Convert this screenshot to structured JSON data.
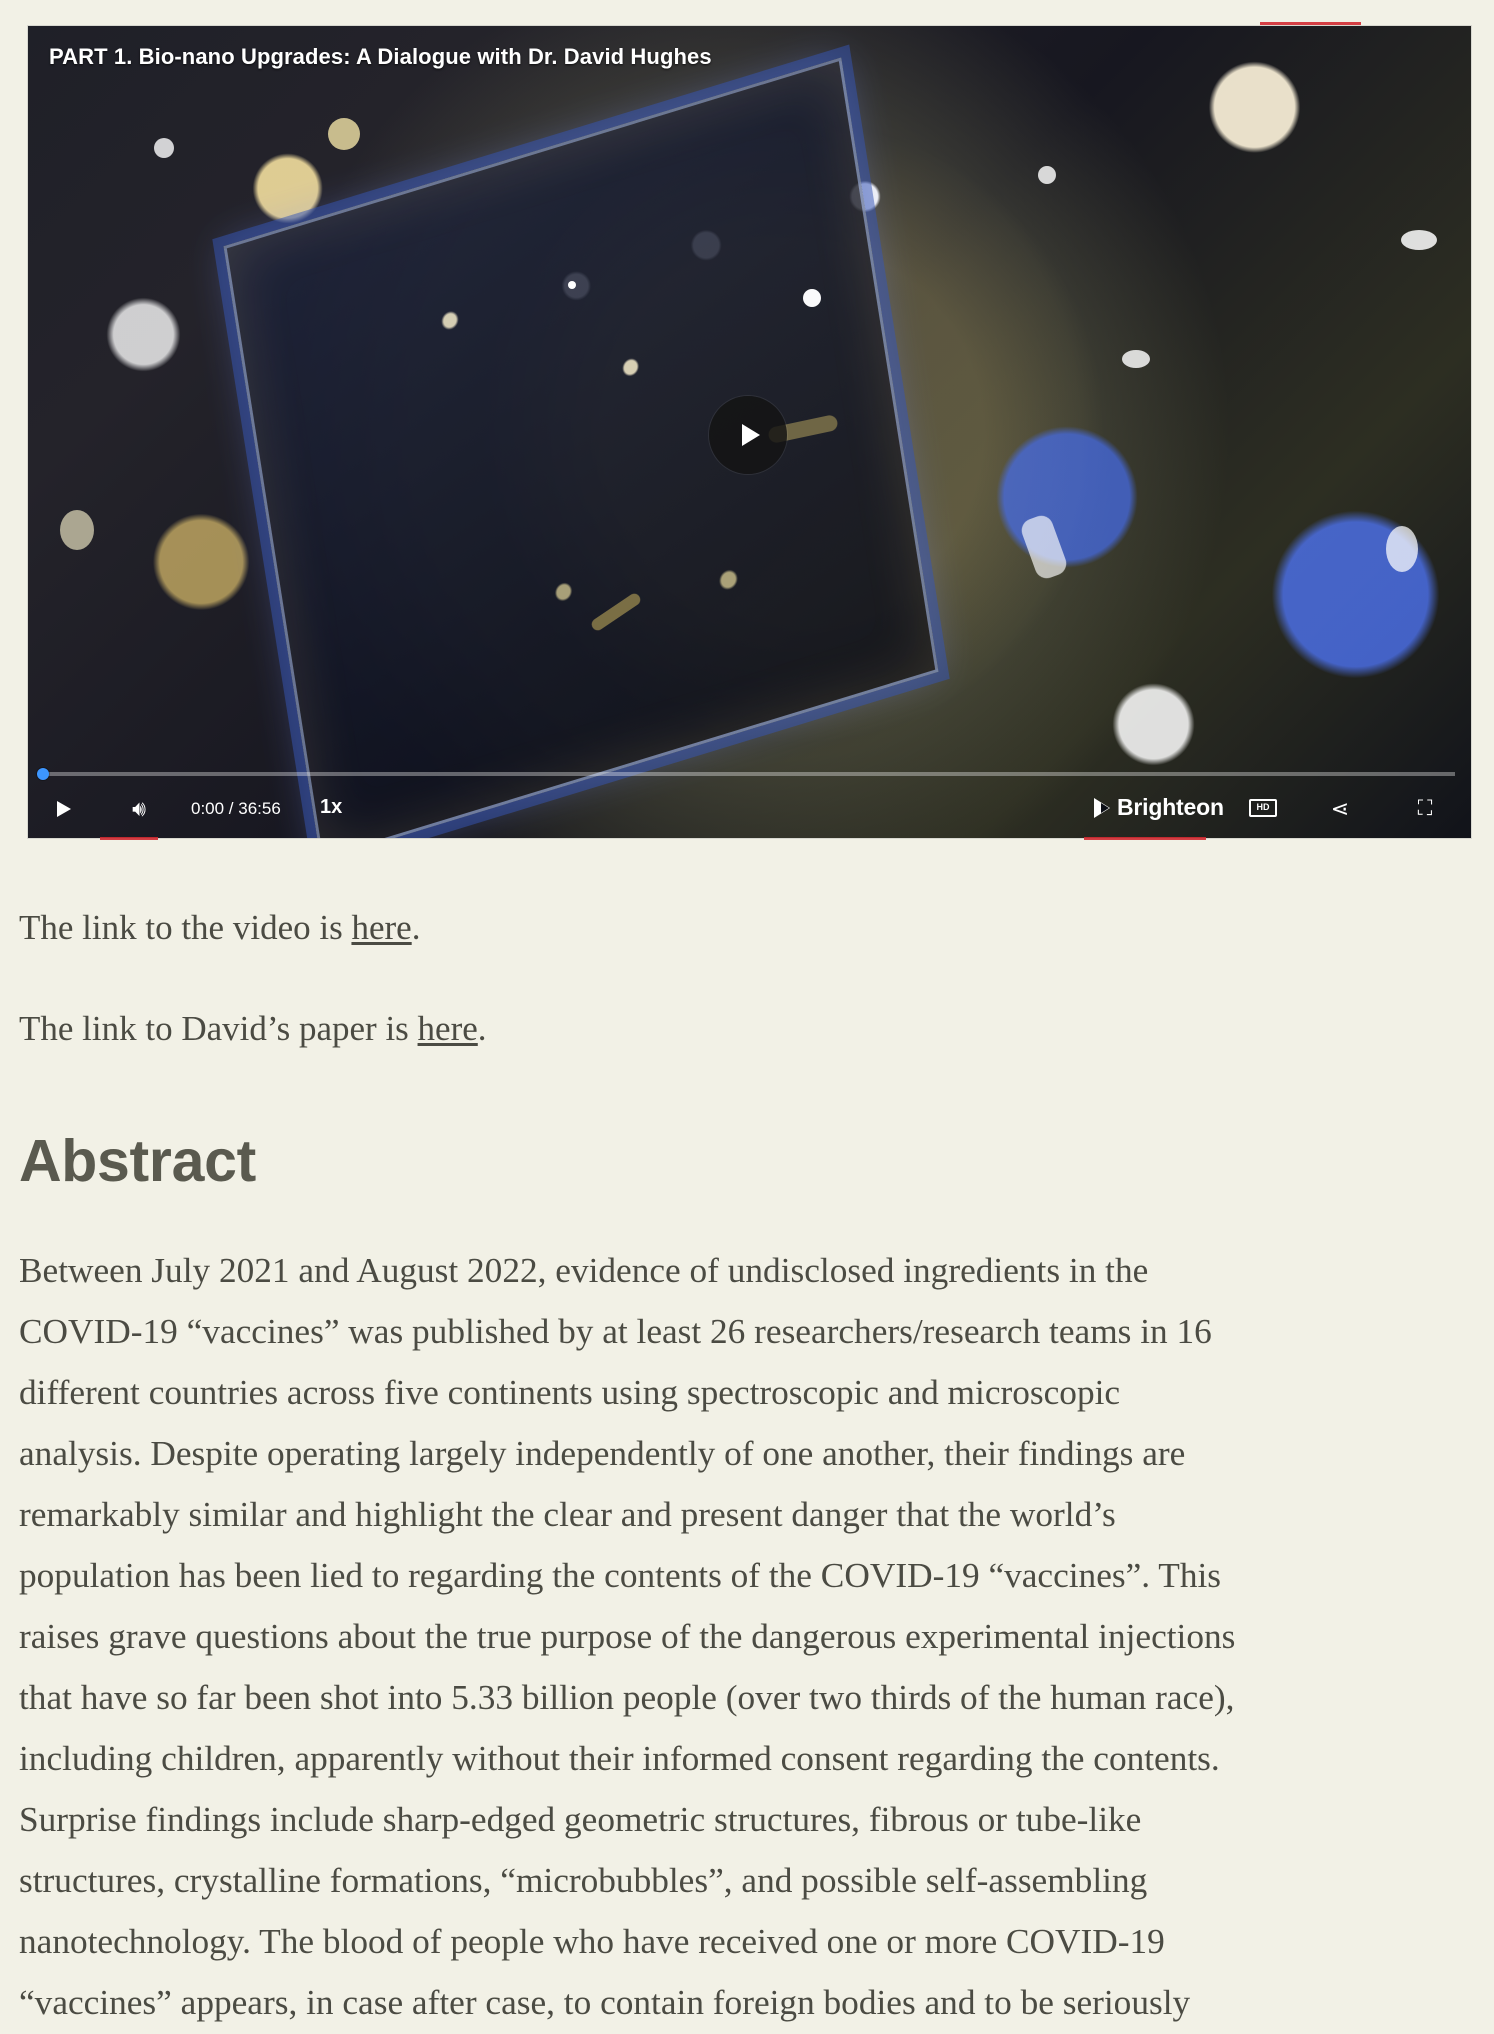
{
  "video": {
    "title": "PART 1. Bio-nano Upgrades: A Dialogue with Dr. David Hughes",
    "time": "0:00 / 36:56",
    "speed": "1x",
    "brand": "Brighteon",
    "hd": "HD",
    "progress_fraction": 0.0,
    "icons": {
      "play": "play-icon",
      "volume": "volume-icon",
      "share": "share-icon",
      "fullscreen": "fullscreen-icon",
      "center_play": "play-icon"
    },
    "colors": {
      "progress": "#3d96ff",
      "accent_red": "#d22b32"
    }
  },
  "links": {
    "video_line_prefix": "The link to the video is ",
    "video_link_label": "here",
    "video_line_suffix": ".",
    "paper_line_prefix": "The link to David’s paper is ",
    "paper_link_label": "here",
    "paper_line_suffix": "."
  },
  "abstract": {
    "heading": "Abstract",
    "lines": [
      "Between July 2021 and August 2022, evidence of undisclosed ingredients in the",
      "COVID-19 “vaccines” was published by at least 26 researchers/research teams in 16",
      "different countries across five continents using spectroscopic and microscopic",
      "analysis. Despite operating largely independently of one another, their findings are",
      "remarkably similar and highlight the clear and present danger that the world’s",
      "population has been lied to regarding the contents of the COVID-19 “vaccines”. This",
      "raises grave questions about the true purpose of the dangerous experimental injections",
      "that have so far been shot into 5.33 billion people (over two thirds of the human race),",
      "including children, apparently without their informed consent regarding the contents.",
      "Surprise findings include sharp-edged geometric structures, fibrous or tube-like",
      "structures, crystalline formations, “microbubbles”, and possible self-assembling",
      "nanotechnology. The blood of people who have received one or more COVID-19",
      "“vaccines” appears, in case after case, to contain foreign bodies and to be seriously"
    ]
  }
}
